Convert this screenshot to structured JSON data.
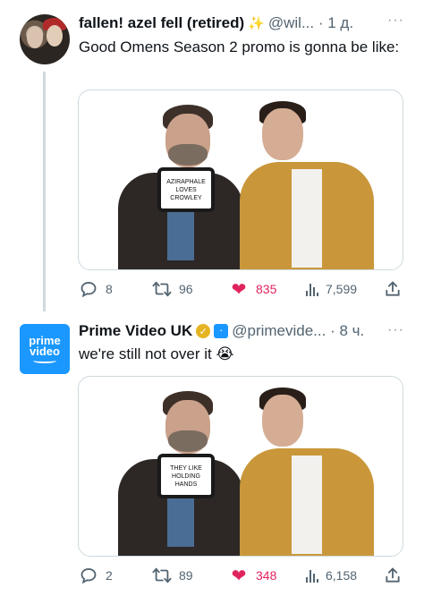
{
  "tweets": [
    {
      "author_name": "fallen! azel fell (retired)",
      "handle_time": "@wil... · 1 д.",
      "text": "Good Omens Season 2 promo is gonna be like:",
      "tablet_text": "AZIRAPHALE\nLOVES\nCROWLEY",
      "replies": "8",
      "retweets": "96",
      "likes": "835",
      "views": "7,599",
      "more": "···"
    },
    {
      "author_name": "Prime Video UK",
      "handle_time": "@primevide... · 8 ч.",
      "text": "we're still not over it 😭",
      "tablet_text": "THEY LIKE\nHOLDING\nHANDS",
      "avatar_logo_line1": "prime",
      "avatar_logo_line2": "video",
      "replies": "2",
      "retweets": "89",
      "likes": "348",
      "views": "6,158",
      "more": "···"
    }
  ],
  "colors": {
    "text": "#0f1419",
    "secondary": "#536471",
    "like": "#e0245e",
    "prime_blue": "#1a98ff",
    "verified_gold": "#e6b422",
    "border": "#cfd9de"
  },
  "icons": [
    "reply-icon",
    "retweet-icon",
    "heart-icon",
    "views-icon",
    "share-icon",
    "sparkle-icon",
    "verified-badge-icon",
    "affiliate-badge-icon",
    "more-icon"
  ]
}
